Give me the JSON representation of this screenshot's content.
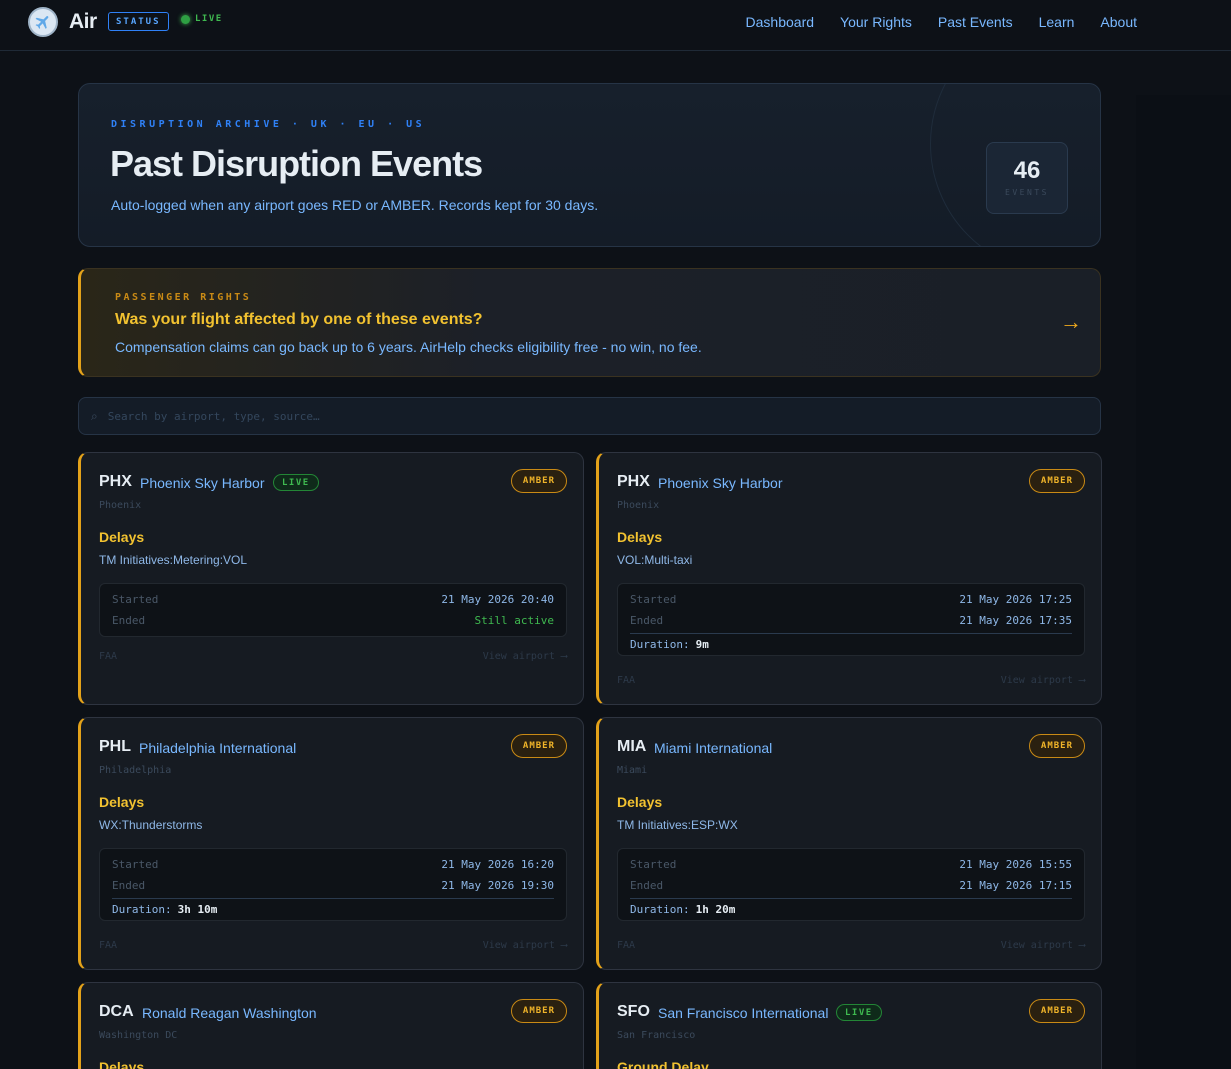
{
  "nav": {
    "brand": "Air",
    "status_label": "STATUS",
    "live_label": "LIVE",
    "links": [
      "Dashboard",
      "Your Rights",
      "Past Events",
      "Learn",
      "About"
    ]
  },
  "hero": {
    "kicker": "DISRUPTION ARCHIVE · UK · EU · US",
    "title": "Past Disruption Events",
    "subtitle": "Auto-logged when any airport goes RED or AMBER. Records kept for 30 days.",
    "count": "46",
    "count_label": "EVENTS"
  },
  "banner": {
    "kicker": "PASSENGER RIGHTS",
    "title": "Was your flight affected by one of these events?",
    "subtitle": "Compensation claims can go back up to 6 years. AirHelp checks eligibility free - no win, no fee.",
    "arrow": "→"
  },
  "search": {
    "placeholder": "Search by airport, type, source…",
    "icon": "⌕"
  },
  "labels": {
    "started": "Started",
    "ended": "Ended",
    "duration": "Duration:",
    "view": "View airport ⟶",
    "live": "LIVE"
  },
  "colors": {
    "accent": "#2f81f7",
    "amber": "#e3a21a",
    "live": "#3fb950"
  },
  "cards": [
    {
      "code": "PHX",
      "name": "Phoenix Sky Harbor",
      "live": true,
      "badge": "AMBER",
      "city": "Phoenix",
      "type": "Delays",
      "reason": "TM Initiatives:Metering:VOL",
      "started": "21 May 2026 20:40",
      "ended": "Still active",
      "duration": "",
      "source": "FAA"
    },
    {
      "code": "PHX",
      "name": "Phoenix Sky Harbor",
      "live": false,
      "badge": "AMBER",
      "city": "Phoenix",
      "type": "Delays",
      "reason": "VOL:Multi-taxi",
      "started": "21 May 2026 17:25",
      "ended": "21 May 2026 17:35",
      "duration": "9m",
      "source": "FAA"
    },
    {
      "code": "PHL",
      "name": "Philadelphia International",
      "live": false,
      "badge": "AMBER",
      "city": "Philadelphia",
      "type": "Delays",
      "reason": "WX:Thunderstorms",
      "started": "21 May 2026 16:20",
      "ended": "21 May 2026 19:30",
      "duration": "3h 10m",
      "source": "FAA"
    },
    {
      "code": "MIA",
      "name": "Miami International",
      "live": false,
      "badge": "AMBER",
      "city": "Miami",
      "type": "Delays",
      "reason": "TM Initiatives:ESP:WX",
      "started": "21 May 2026 15:55",
      "ended": "21 May 2026 17:15",
      "duration": "1h 20m",
      "source": "FAA"
    },
    {
      "code": "DCA",
      "name": "Ronald Reagan Washington",
      "live": false,
      "badge": "AMBER",
      "city": "Washington DC",
      "type": "Delays",
      "reason": "",
      "started": "",
      "ended": "",
      "duration": "",
      "source": ""
    },
    {
      "code": "SFO",
      "name": "San Francisco International",
      "live": true,
      "badge": "AMBER",
      "city": "San Francisco",
      "type": "Ground Delay",
      "reason": "",
      "started": "",
      "ended": "",
      "duration": "",
      "source": ""
    }
  ]
}
